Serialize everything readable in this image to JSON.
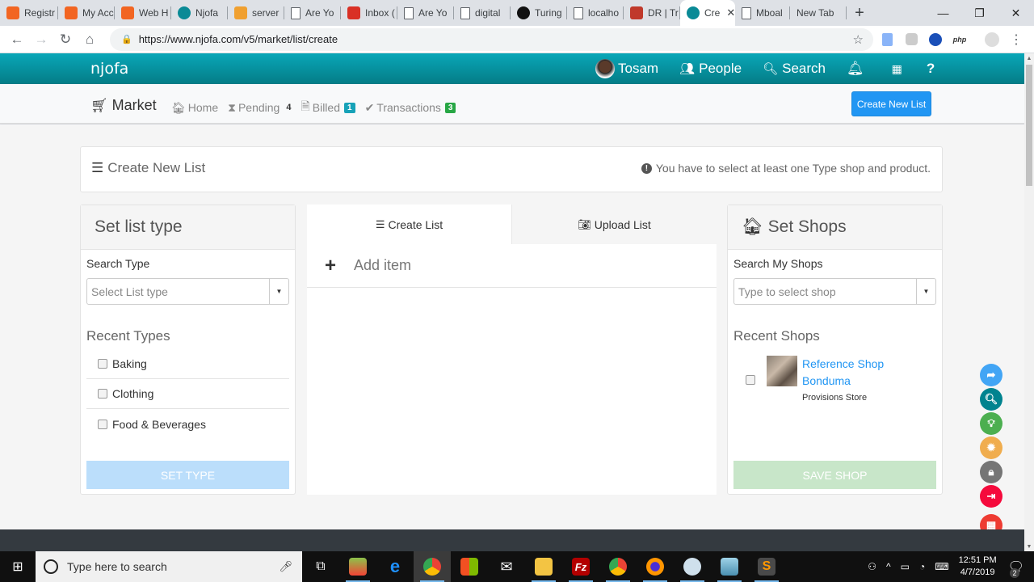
{
  "browser": {
    "tabs": [
      {
        "label": "Registr",
        "icon": "njofa-orange-icon",
        "color": "#f26522"
      },
      {
        "label": "My Acc",
        "icon": "njofa-orange-icon",
        "color": "#f26522"
      },
      {
        "label": "Web H",
        "icon": "njofa-orange-icon",
        "color": "#f26522"
      },
      {
        "label": "Njofa",
        "icon": "njofa-teal-icon",
        "color": "#0a8a96"
      },
      {
        "label": "server",
        "icon": "pma-icon",
        "color": "#f0a030"
      },
      {
        "label": "Are Yo",
        "icon": "page-icon",
        "color": "#ffffff"
      },
      {
        "label": "Inbox (",
        "icon": "gmail-icon",
        "color": "#d93025"
      },
      {
        "label": "Are Yo",
        "icon": "page-icon",
        "color": "#ffffff"
      },
      {
        "label": "digital",
        "icon": "page-icon",
        "color": "#ffffff"
      },
      {
        "label": "Turing",
        "icon": "turing-icon",
        "color": "#111111"
      },
      {
        "label": "localho",
        "icon": "page-icon",
        "color": "#ffffff"
      },
      {
        "label": "DR | Tr",
        "icon": "dr-icon",
        "color": "#c0392b"
      },
      {
        "label": "Cre",
        "icon": "njofa-teal-icon",
        "color": "#0a8a96",
        "active": true
      },
      {
        "label": "Mboal",
        "icon": "page-icon",
        "color": "#ffffff"
      },
      {
        "label": "New Tab",
        "icon": "",
        "color": ""
      }
    ],
    "url": "https://www.njofa.com/v5/market/list/create",
    "window_controls": {
      "minimize": "—",
      "restore": "❐",
      "close": "✕"
    }
  },
  "app": {
    "logo": "njofa",
    "user": "Tosam",
    "nav": {
      "people": "People",
      "search": "Search"
    },
    "subnav": {
      "market": "Market",
      "home": "Home",
      "pending": "Pending",
      "pending_count": "4",
      "billed": "Billed",
      "billed_count": "1",
      "transactions": "Transactions",
      "transactions_count": "3",
      "create_button": "Create New List"
    },
    "colors": {
      "header_teal": "#0597a5",
      "primary": "#2196f3",
      "badge_blue": "#17a2b8",
      "badge_green": "#28a745"
    }
  },
  "page": {
    "title": "Create New List",
    "notice": "You have to select at least one Type shop and product.",
    "list_type": {
      "heading": "Set list type",
      "search_label": "Search Type",
      "placeholder": "Select List type",
      "recent_label": "Recent Types",
      "types": [
        {
          "label": "Baking",
          "checked": false
        },
        {
          "label": "Clothing",
          "checked": false
        },
        {
          "label": "Food & Beverages",
          "checked": false
        }
      ],
      "button": "SET TYPE"
    },
    "center": {
      "tabs": [
        {
          "label": "Create List",
          "active": true
        },
        {
          "label": "Upload List",
          "active": false
        }
      ],
      "add_item": "Add item"
    },
    "shops": {
      "heading": "Set Shops",
      "search_label": "Search My Shops",
      "placeholder": "Type to select shop",
      "recent_label": "Recent Shops",
      "items": [
        {
          "name_line1": "Reference Shop",
          "name_line2": "Bonduma",
          "type": "Provisions Store",
          "checked": false
        }
      ],
      "button": "SAVE SHOP"
    }
  },
  "fabs": [
    {
      "name": "share",
      "color": "#42a5f5"
    },
    {
      "name": "search",
      "color": "#00838f"
    },
    {
      "name": "idea",
      "color": "#4caf50"
    },
    {
      "name": "bug",
      "color": "#f0ad4e"
    },
    {
      "name": "lock",
      "color": "#757575"
    },
    {
      "name": "logout",
      "color": "#f50a3c"
    },
    {
      "name": "apps",
      "color": "#ee3b32"
    }
  ],
  "taskbar": {
    "search_placeholder": "Type here to search",
    "time": "12:51 PM",
    "date": "4/7/2019",
    "notifications": "2"
  }
}
